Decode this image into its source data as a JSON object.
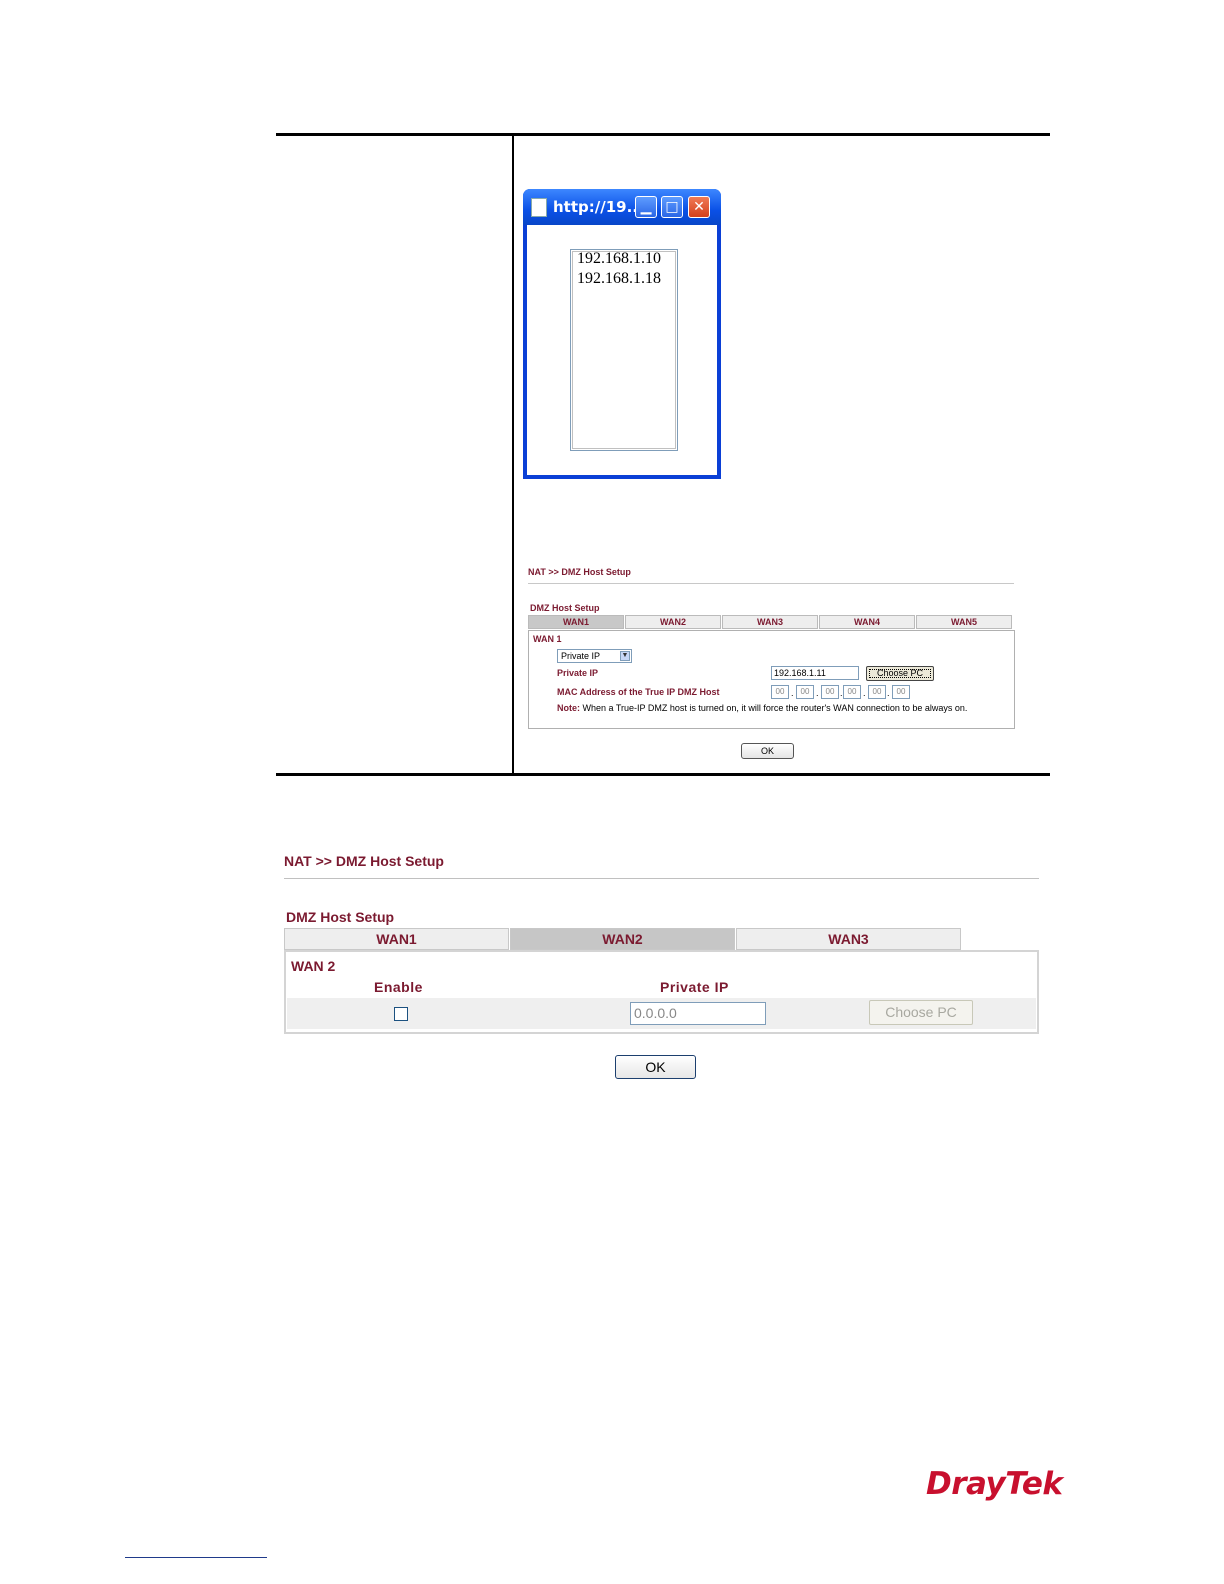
{
  "popup": {
    "title": "http://19...",
    "min_glyph": "▁",
    "max_glyph": "□",
    "close_glyph": "✕",
    "ip_list": [
      "192.168.1.10",
      "192.168.1.18"
    ]
  },
  "small_screenshot": {
    "header": "NAT >> DMZ Host Setup",
    "section": "DMZ Host Setup",
    "tabs": [
      "WAN1",
      "WAN2",
      "WAN3",
      "WAN4",
      "WAN5"
    ],
    "active_tab": "WAN1",
    "panel_title": "WAN 1",
    "mode_select": "Private IP",
    "private_ip_label": "Private IP",
    "private_ip_value": "192.168.1.11",
    "choose_pc": "Choose PC",
    "mac_label": "MAC Address of the True IP DMZ Host",
    "mac_values": [
      "00",
      "00",
      "00",
      "00",
      "00",
      "00"
    ],
    "mac_separator": ".",
    "note_label": "Note:",
    "note_text": "When a True-IP DMZ host is turned on, it will force the router's WAN connection to be always on.",
    "ok": "OK"
  },
  "large_screenshot": {
    "header": "NAT >> DMZ Host Setup",
    "section": "DMZ Host Setup",
    "tabs": [
      "WAN1",
      "WAN2",
      "WAN3"
    ],
    "active_tab": "WAN2",
    "panel_title": "WAN 2",
    "enable_header": "Enable",
    "private_ip_header": "Private IP",
    "enable_checked": false,
    "private_ip_value": "0.0.0.0",
    "choose_pc": "Choose PC",
    "ok": "OK"
  },
  "footer": {
    "logo_text": "DrayTek"
  },
  "colors": {
    "label_maroon": "#7b1a30",
    "logo_red": "#c8102e",
    "titlebar_blue": "#0a50e6"
  }
}
